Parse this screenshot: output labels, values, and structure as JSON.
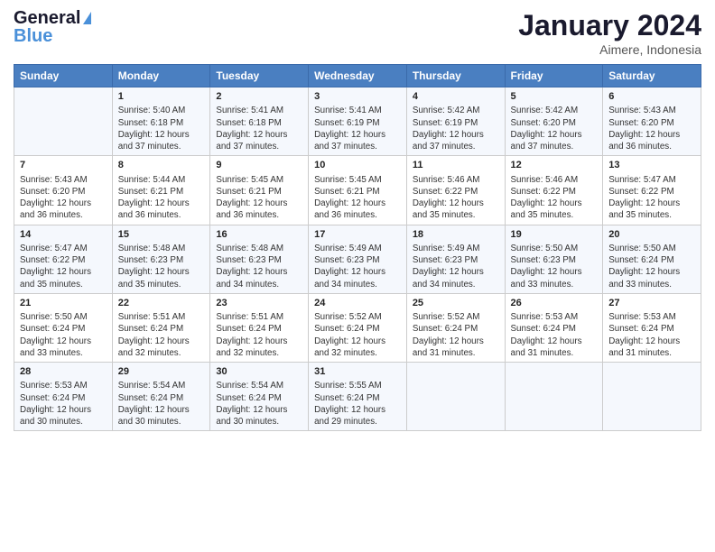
{
  "header": {
    "logo_general": "General",
    "logo_blue": "Blue",
    "main_title": "January 2024",
    "subtitle": "Aimere, Indonesia"
  },
  "columns": [
    "Sunday",
    "Monday",
    "Tuesday",
    "Wednesday",
    "Thursday",
    "Friday",
    "Saturday"
  ],
  "weeks": [
    [
      {
        "day": "",
        "info": ""
      },
      {
        "day": "1",
        "info": "Sunrise: 5:40 AM\nSunset: 6:18 PM\nDaylight: 12 hours\nand 37 minutes."
      },
      {
        "day": "2",
        "info": "Sunrise: 5:41 AM\nSunset: 6:18 PM\nDaylight: 12 hours\nand 37 minutes."
      },
      {
        "day": "3",
        "info": "Sunrise: 5:41 AM\nSunset: 6:19 PM\nDaylight: 12 hours\nand 37 minutes."
      },
      {
        "day": "4",
        "info": "Sunrise: 5:42 AM\nSunset: 6:19 PM\nDaylight: 12 hours\nand 37 minutes."
      },
      {
        "day": "5",
        "info": "Sunrise: 5:42 AM\nSunset: 6:20 PM\nDaylight: 12 hours\nand 37 minutes."
      },
      {
        "day": "6",
        "info": "Sunrise: 5:43 AM\nSunset: 6:20 PM\nDaylight: 12 hours\nand 36 minutes."
      }
    ],
    [
      {
        "day": "7",
        "info": "Sunrise: 5:43 AM\nSunset: 6:20 PM\nDaylight: 12 hours\nand 36 minutes."
      },
      {
        "day": "8",
        "info": "Sunrise: 5:44 AM\nSunset: 6:21 PM\nDaylight: 12 hours\nand 36 minutes."
      },
      {
        "day": "9",
        "info": "Sunrise: 5:45 AM\nSunset: 6:21 PM\nDaylight: 12 hours\nand 36 minutes."
      },
      {
        "day": "10",
        "info": "Sunrise: 5:45 AM\nSunset: 6:21 PM\nDaylight: 12 hours\nand 36 minutes."
      },
      {
        "day": "11",
        "info": "Sunrise: 5:46 AM\nSunset: 6:22 PM\nDaylight: 12 hours\nand 35 minutes."
      },
      {
        "day": "12",
        "info": "Sunrise: 5:46 AM\nSunset: 6:22 PM\nDaylight: 12 hours\nand 35 minutes."
      },
      {
        "day": "13",
        "info": "Sunrise: 5:47 AM\nSunset: 6:22 PM\nDaylight: 12 hours\nand 35 minutes."
      }
    ],
    [
      {
        "day": "14",
        "info": "Sunrise: 5:47 AM\nSunset: 6:22 PM\nDaylight: 12 hours\nand 35 minutes."
      },
      {
        "day": "15",
        "info": "Sunrise: 5:48 AM\nSunset: 6:23 PM\nDaylight: 12 hours\nand 35 minutes."
      },
      {
        "day": "16",
        "info": "Sunrise: 5:48 AM\nSunset: 6:23 PM\nDaylight: 12 hours\nand 34 minutes."
      },
      {
        "day": "17",
        "info": "Sunrise: 5:49 AM\nSunset: 6:23 PM\nDaylight: 12 hours\nand 34 minutes."
      },
      {
        "day": "18",
        "info": "Sunrise: 5:49 AM\nSunset: 6:23 PM\nDaylight: 12 hours\nand 34 minutes."
      },
      {
        "day": "19",
        "info": "Sunrise: 5:50 AM\nSunset: 6:23 PM\nDaylight: 12 hours\nand 33 minutes."
      },
      {
        "day": "20",
        "info": "Sunrise: 5:50 AM\nSunset: 6:24 PM\nDaylight: 12 hours\nand 33 minutes."
      }
    ],
    [
      {
        "day": "21",
        "info": "Sunrise: 5:50 AM\nSunset: 6:24 PM\nDaylight: 12 hours\nand 33 minutes."
      },
      {
        "day": "22",
        "info": "Sunrise: 5:51 AM\nSunset: 6:24 PM\nDaylight: 12 hours\nand 32 minutes."
      },
      {
        "day": "23",
        "info": "Sunrise: 5:51 AM\nSunset: 6:24 PM\nDaylight: 12 hours\nand 32 minutes."
      },
      {
        "day": "24",
        "info": "Sunrise: 5:52 AM\nSunset: 6:24 PM\nDaylight: 12 hours\nand 32 minutes."
      },
      {
        "day": "25",
        "info": "Sunrise: 5:52 AM\nSunset: 6:24 PM\nDaylight: 12 hours\nand 31 minutes."
      },
      {
        "day": "26",
        "info": "Sunrise: 5:53 AM\nSunset: 6:24 PM\nDaylight: 12 hours\nand 31 minutes."
      },
      {
        "day": "27",
        "info": "Sunrise: 5:53 AM\nSunset: 6:24 PM\nDaylight: 12 hours\nand 31 minutes."
      }
    ],
    [
      {
        "day": "28",
        "info": "Sunrise: 5:53 AM\nSunset: 6:24 PM\nDaylight: 12 hours\nand 30 minutes."
      },
      {
        "day": "29",
        "info": "Sunrise: 5:54 AM\nSunset: 6:24 PM\nDaylight: 12 hours\nand 30 minutes."
      },
      {
        "day": "30",
        "info": "Sunrise: 5:54 AM\nSunset: 6:24 PM\nDaylight: 12 hours\nand 30 minutes."
      },
      {
        "day": "31",
        "info": "Sunrise: 5:55 AM\nSunset: 6:24 PM\nDaylight: 12 hours\nand 29 minutes."
      },
      {
        "day": "",
        "info": ""
      },
      {
        "day": "",
        "info": ""
      },
      {
        "day": "",
        "info": ""
      }
    ]
  ]
}
